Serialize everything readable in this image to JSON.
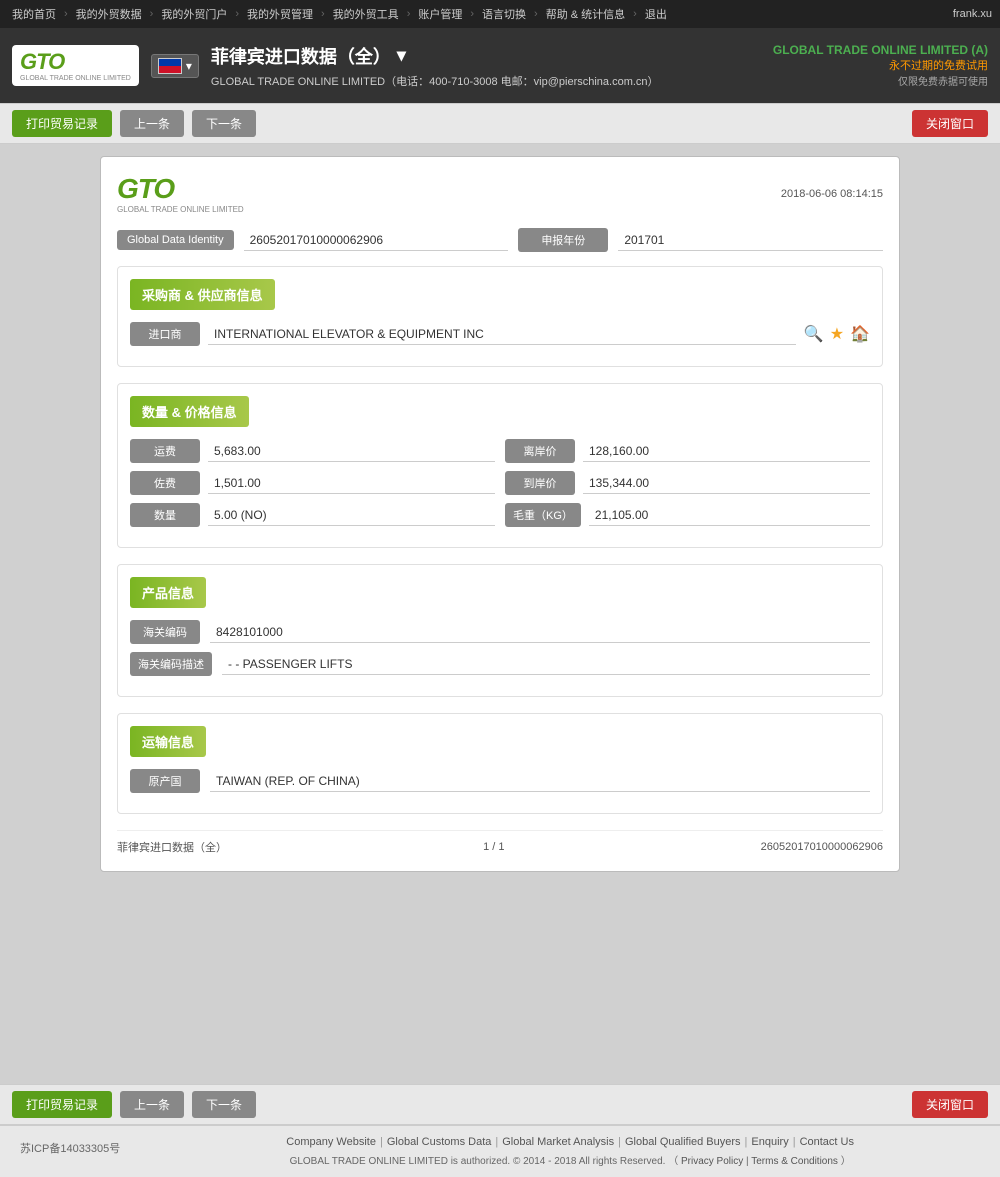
{
  "nav": {
    "items": [
      "我的首页",
      "我的外贸数据",
      "我的外贸门户",
      "我的外贸管理",
      "我的外贸工具",
      "账户管理",
      "语言切换",
      "帮助 & 统计信息",
      "退出"
    ],
    "username": "frank.xu"
  },
  "header": {
    "title": "菲律宾进口数据（全）",
    "title_arrow": "▾",
    "phone": "400-710-3008",
    "email": "vip@pierschina.com.cn",
    "contact_line": "GLOBAL TRADE ONLINE LIMITED（电话：400-710-3008  电邮：vip@pierschina.com.cn）",
    "company_top": "GLOBAL TRADE ONLINE LIMITED (A)",
    "trial_label": "永不过期的免费试用",
    "trial_sub": "仅限免费赤据可使用"
  },
  "toolbar": {
    "print_btn": "打印贸易记录",
    "prev_btn": "上一条",
    "next_btn": "下一条",
    "close_btn": "关闭窗口"
  },
  "record": {
    "timestamp": "2018-06-06  08:14:15",
    "logo_gto": "GTO",
    "logo_sub": "GLOBAL TRADE ONLINE LIMITED",
    "global_data_identity_label": "Global Data Identity",
    "global_data_identity_value": "26052017010000062906",
    "declaration_year_label": "申报年份",
    "declaration_year_value": "201701",
    "section_supplier": "采购商 & 供应商信息",
    "importer_label": "进口商",
    "importer_value": "INTERNATIONAL ELEVATOR & EQUIPMENT INC",
    "section_quantity": "数量 & 价格信息",
    "freight_label": "运费",
    "freight_value": "5,683.00",
    "departure_price_label": "离岸价",
    "departure_price_value": "128,160.00",
    "storage_label": "佐费",
    "storage_value": "1,501.00",
    "arrival_price_label": "到岸价",
    "arrival_price_value": "135,344.00",
    "quantity_label": "数量",
    "quantity_value": "5.00 (NO)",
    "gross_weight_label": "毛重（KG）",
    "gross_weight_value": "21,105.00",
    "section_product": "产品信息",
    "customs_code_label": "海关编码",
    "customs_code_value": "8428101000",
    "customs_desc_label": "海关编码描述",
    "customs_desc_value": "- - PASSENGER LIFTS",
    "section_transport": "运输信息",
    "origin_country_label": "原产国",
    "origin_country_value": "TAIWAN (REP. OF CHINA)",
    "footer_source": "菲律宾进口数据（全）",
    "footer_page": "1 / 1",
    "footer_id": "26052017010000062906"
  },
  "footer": {
    "icp": "苏ICP备14033305号",
    "links": [
      "Company Website",
      "Global Customs Data",
      "Global Market Analysis",
      "Global Qualified Buyers",
      "Enquiry",
      "Contact Us"
    ],
    "copyright": "GLOBAL TRADE ONLINE LIMITED is authorized. © 2014 - 2018 All rights Reserved.",
    "privacy_label": "Privacy Policy",
    "terms_label": "Terms & Conditions",
    "copyright_full": "GLOBAL TRADE ONLINE LIMITED is authorized. © 2014 - 2018 All rights Reserved.  （"
  }
}
